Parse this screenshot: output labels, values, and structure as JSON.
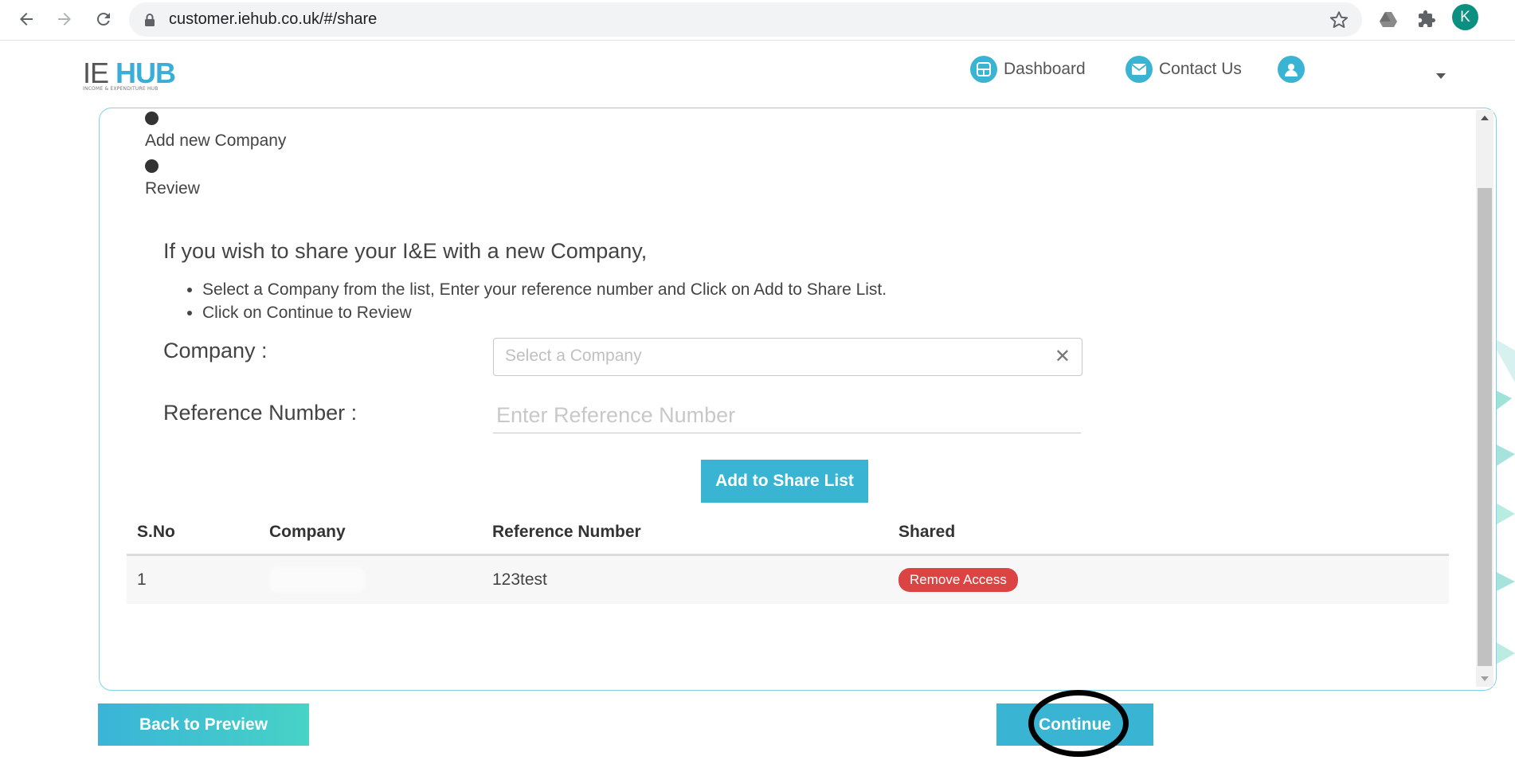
{
  "browser": {
    "url": "customer.iehub.co.uk/#/share",
    "profile_initial": "K"
  },
  "header": {
    "logo_ie": "IE",
    "logo_hub": "HUB",
    "logo_tagline": "INCOME & EXPENDITURE HUB",
    "nav": [
      {
        "label": "Dashboard",
        "icon": "dashboard-icon"
      },
      {
        "label": "Contact Us",
        "icon": "mail-icon"
      }
    ]
  },
  "steps": [
    {
      "label": "Add new Company"
    },
    {
      "label": "Review"
    }
  ],
  "content": {
    "intro": "If you wish to share your I&E with a new Company,",
    "instructions": [
      "Select a Company from the list, Enter your reference number and Click on Add to Share List.",
      "Click on Continue to Review"
    ],
    "company_label": "Company :",
    "company_placeholder": "Select a Company",
    "reference_label": "Reference Number :",
    "reference_placeholder": "Enter Reference Number",
    "add_button": "Add to Share List"
  },
  "table": {
    "headers": [
      "S.No",
      "Company",
      "Reference Number",
      "Shared"
    ],
    "rows": [
      {
        "sno": "1",
        "company": "",
        "reference": "123test",
        "action": "Remove Access"
      }
    ]
  },
  "footer": {
    "back_button": "Back to Preview",
    "continue_button": "Continue"
  },
  "colors": {
    "accent": "#3ab4d3",
    "danger": "#dc4444",
    "panel_border": "#7ed3e4"
  }
}
